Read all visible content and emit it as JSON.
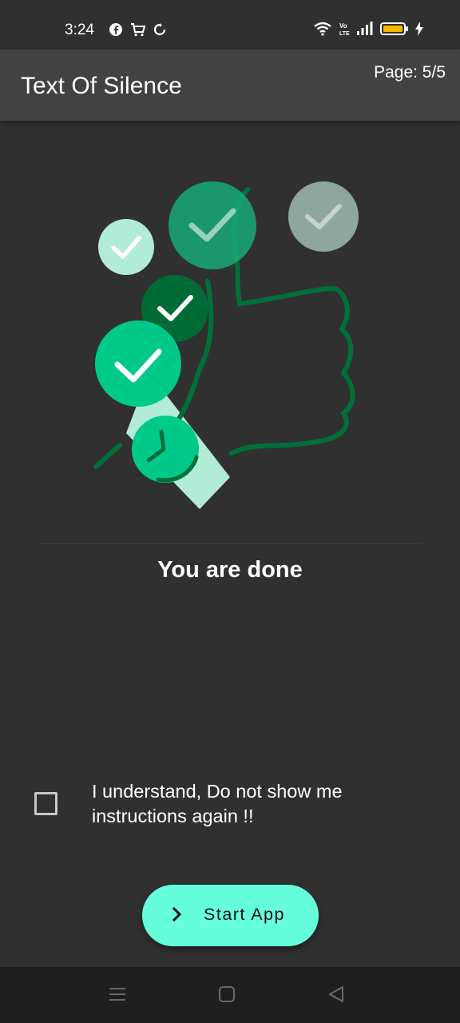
{
  "status_bar": {
    "time": "3:24",
    "left_icons": [
      "facebook-icon",
      "shopping-cart-icon",
      "sync-icon"
    ],
    "right_icons": [
      "wifi-icon",
      "volte-icon",
      "signal-icon",
      "battery-icon",
      "charging-icon"
    ]
  },
  "app_bar": {
    "title": "Text Of Silence",
    "page_indicator": "Page: 5/5"
  },
  "content": {
    "illustration_icon": "thumbs-up-checkmarks-illustration",
    "heading": "You are done",
    "checkbox_label": "I understand, Do not show me instructions again !!",
    "checkbox_checked": false
  },
  "action": {
    "start_label": "Start App",
    "start_icon": "chevron-right-icon",
    "button_color": "#64ffda"
  },
  "nav_bar": {
    "icons": [
      "menu-icon",
      "home-icon",
      "back-icon"
    ]
  },
  "colors": {
    "background": "#303030",
    "app_bar": "#424242",
    "accent_green": "#00c98a"
  }
}
